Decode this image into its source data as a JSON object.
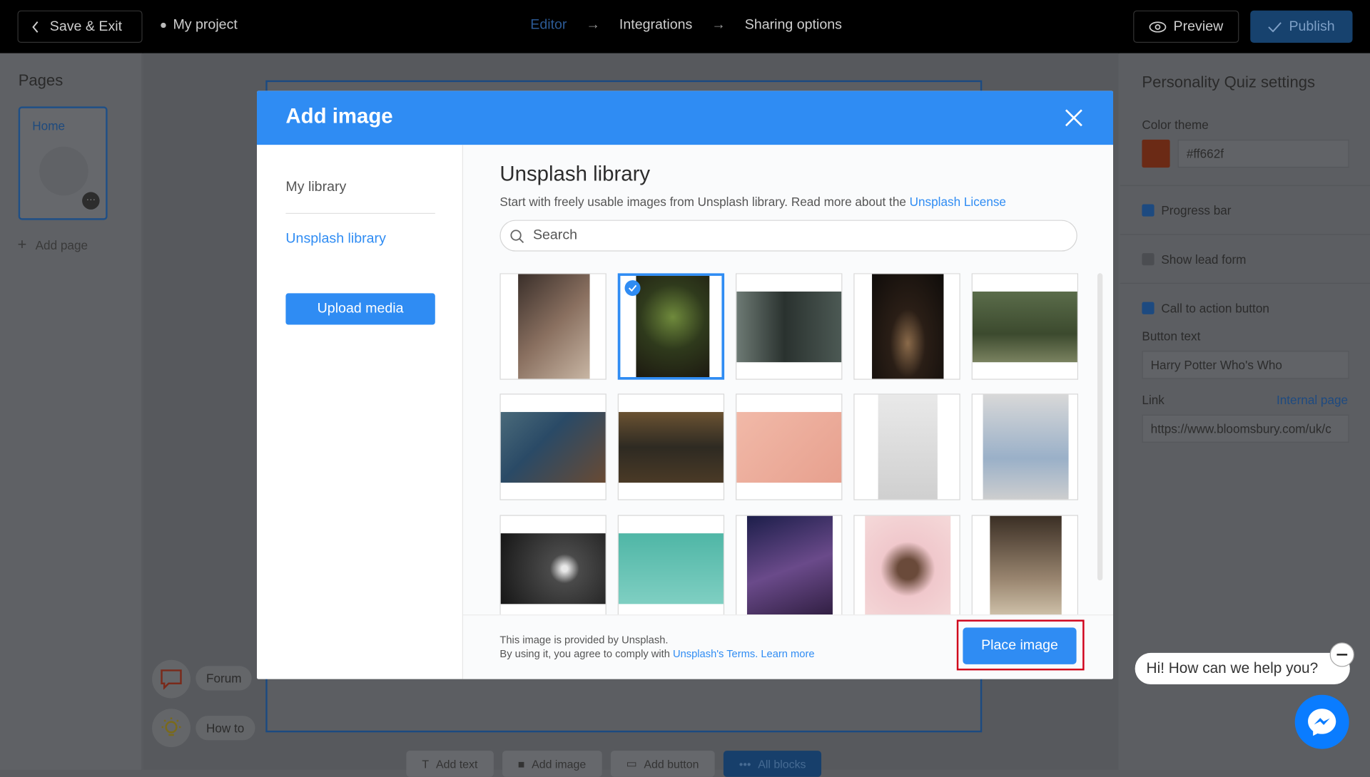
{
  "topbar": {
    "save_exit": "Save & Exit",
    "project": "My project",
    "steps": [
      "Editor",
      "Integrations",
      "Sharing options"
    ],
    "preview": "Preview",
    "publish": "Publish"
  },
  "left_panel": {
    "title": "Pages",
    "page_label": "Home",
    "add_page": "Add page"
  },
  "canvas": {
    "tools": [
      "Add text",
      "Add image",
      "Add button",
      "All blocks"
    ],
    "forum": "Forum",
    "howto": "How to"
  },
  "right_panel": {
    "title": "Personality Quiz settings",
    "color_theme_label": "Color theme",
    "color_value": "#ff662f",
    "progress_bar": "Progress bar",
    "show_lead_form": "Show lead form",
    "cta_button": "Call to action button",
    "button_text_label": "Button text",
    "button_text_value": "Harry Potter Who's Who",
    "link_label": "Link",
    "internal_page": "Internal page",
    "link_value": "https://www.bloomsbury.com/uk/c"
  },
  "modal": {
    "title": "Add image",
    "sidebar": {
      "my_library": "My library",
      "unsplash_library": "Unsplash library",
      "upload": "Upload media"
    },
    "heading": "Unsplash library",
    "description": "Start with freely usable images from Unsplash library. Read more about the ",
    "license_link": "Unsplash License",
    "search_placeholder": "Search",
    "footer_line1": "This image is provided by Unsplash.",
    "footer_line2": "By using it, you agree to comply with ",
    "terms_link": "Unsplash's Terms.",
    "learn_more": "Learn more",
    "place_button": "Place image",
    "selected_index": 1
  },
  "chat": {
    "prompt": "Hi! How can we help you?"
  },
  "colors": {
    "accent": "#2f8cf3",
    "highlight": "#d0021b",
    "messenger": "#0a7cff"
  },
  "icons": [
    "chevron-left-icon",
    "eye-icon",
    "check-icon",
    "arrow-right-icon",
    "plus-icon",
    "close-icon",
    "search-icon",
    "chat-icon",
    "bulb-icon",
    "messenger-icon",
    "minus-icon"
  ]
}
